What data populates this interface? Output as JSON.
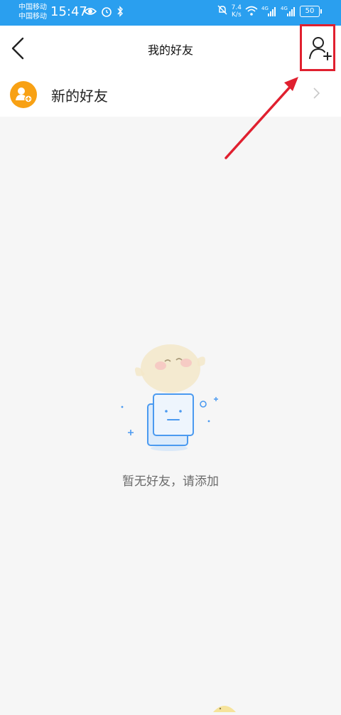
{
  "status_bar": {
    "carrier1": "中国移动",
    "carrier2": "中国移动",
    "time": "15:47",
    "speed_value": "7.4",
    "speed_unit": "K/s",
    "signal_label1": "4G",
    "signal_label2": "4G",
    "battery": "50"
  },
  "header": {
    "title": "我的好友"
  },
  "list": {
    "new_friends_label": "新的好友"
  },
  "empty_state": {
    "message": "暂无好友，请添加"
  },
  "colors": {
    "status_bar_bg": "#2a9fef",
    "accent_orange": "#f8a114",
    "highlight_red": "#e0202f"
  }
}
